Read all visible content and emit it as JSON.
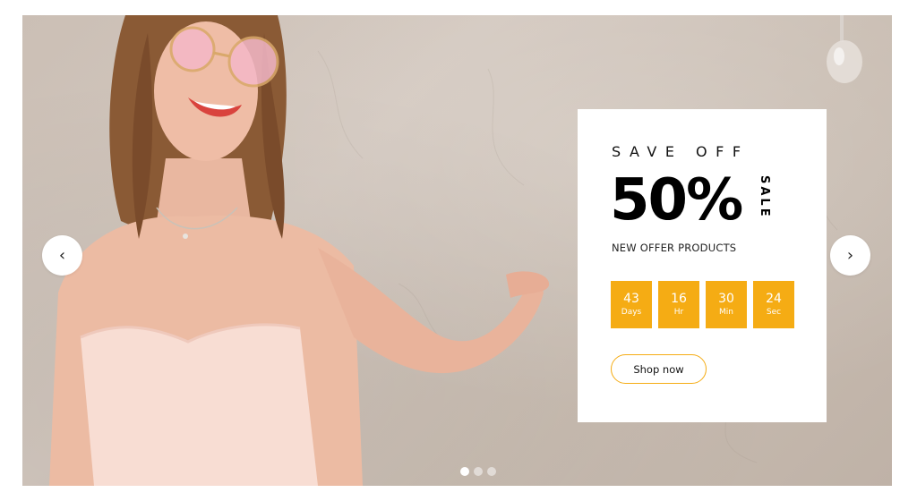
{
  "promo": {
    "headline": "SAVE OFF",
    "discount": "50%",
    "sale_label": "SALE",
    "subheadline": "NEW OFFER PRODUCTS",
    "accent_color": "#f5ac14"
  },
  "countdown": [
    {
      "value": "43",
      "unit": "Days"
    },
    {
      "value": "16",
      "unit": "Hr"
    },
    {
      "value": "30",
      "unit": "Min"
    },
    {
      "value": "24",
      "unit": "Sec"
    }
  ],
  "cta": {
    "label": "Shop now"
  },
  "navigation": {
    "prev_icon": "chevron-left-icon",
    "next_icon": "chevron-right-icon",
    "prev_glyph": "‹",
    "next_glyph": "›"
  },
  "pagination": {
    "total": 3,
    "active_index": 0
  }
}
